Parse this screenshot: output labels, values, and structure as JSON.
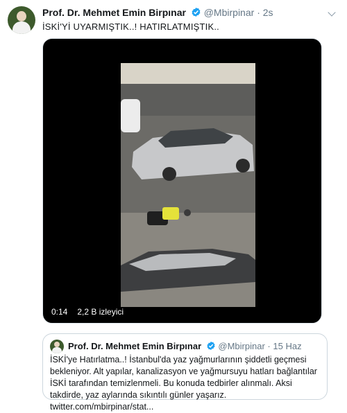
{
  "tweet": {
    "author_name": "Prof. Dr. Mehmet Emin Birpınar",
    "handle": "@Mbirpinar",
    "separator": "·",
    "time": "2s",
    "text": "İSKİ'Yİ UYARMIŞTIK..!  HATIRLATMIŞTIK.."
  },
  "video": {
    "duration": "0:14",
    "views": "2,2 B izleyici"
  },
  "quoted": {
    "author_name": "Prof. Dr. Mehmet Emin Birpınar",
    "handle": "@Mbirpinar",
    "separator": "·",
    "time": "15 Haz",
    "text": "İSKİ'ye Hatırlatma..! İstanbul'da yaz yağmurlarının şiddetli geçmesi bekleniyor. Alt yapılar, kanalizasyon ve yağmursuyu hatları bağlantılar İSKİ tarafından  temizlenmeli. Bu konuda tedbirler alınmalı. Aksi takdirde, yaz aylarında sıkıntılı günler yaşarız. twitter.com/mbirpinar/stat..."
  },
  "colors": {
    "verified": "#1da1f2",
    "secondary_text": "#657786",
    "border": "#ccd6dd"
  },
  "icons": [
    "verified-badge-icon",
    "chevron-down-icon"
  ]
}
